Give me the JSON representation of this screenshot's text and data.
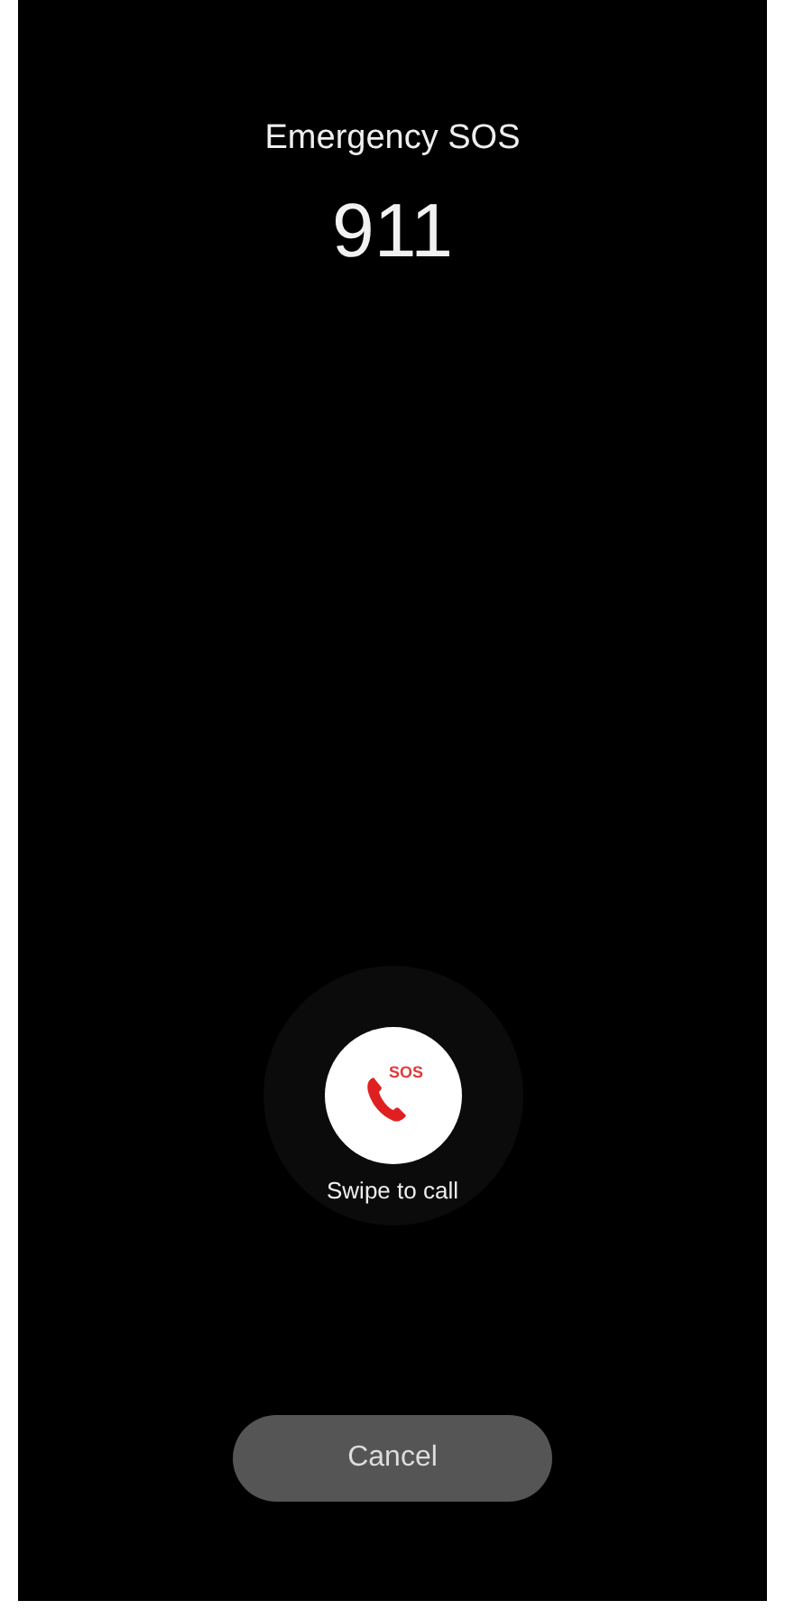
{
  "header": {
    "title": "Emergency SOS",
    "number": "911"
  },
  "swipe": {
    "badge": "SOS",
    "hint": "Swipe to call"
  },
  "buttons": [
    {
      "label": "Cancel"
    }
  ]
}
